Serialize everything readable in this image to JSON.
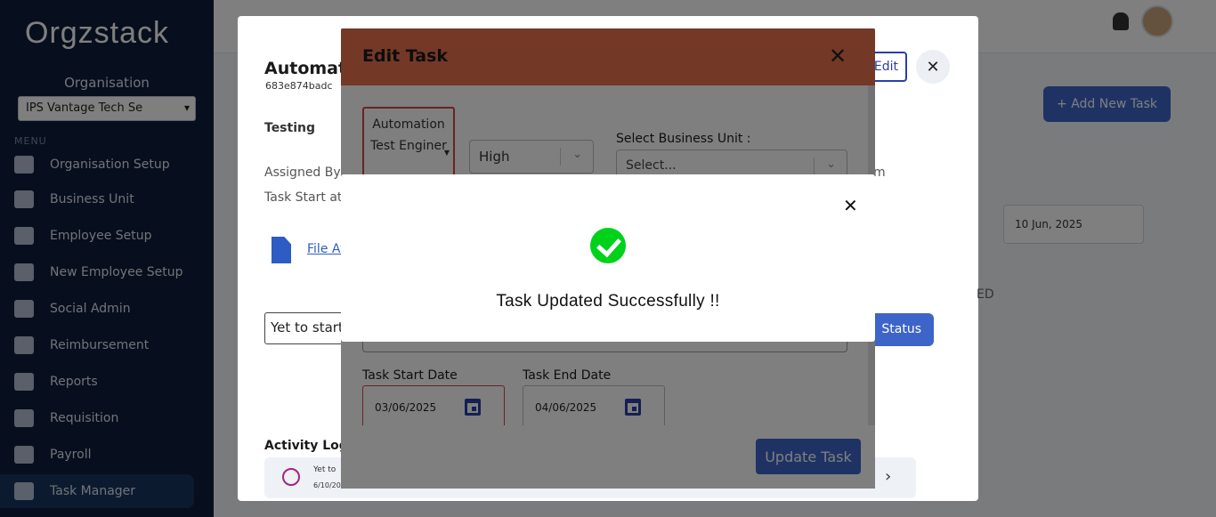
{
  "app": {
    "logo_text": "Orgzstack",
    "organisation_label": "Organisation",
    "organisation_value": "IPS Vantage Tech Se",
    "menu_label": "MENU"
  },
  "sidebar": {
    "items": [
      {
        "label": "Organisation Setup"
      },
      {
        "label": "Business Unit"
      },
      {
        "label": "Employee Setup"
      },
      {
        "label": "New Employee Setup"
      },
      {
        "label": "Social Admin"
      },
      {
        "label": "Reimbursement"
      },
      {
        "label": "Reports"
      },
      {
        "label": "Requisition"
      },
      {
        "label": "Payroll"
      },
      {
        "label": "Task Manager"
      }
    ]
  },
  "page": {
    "add_task_label": "+ Add New Task",
    "date_filter_value": "10 Jun, 2025"
  },
  "task_modal": {
    "title": "Automat",
    "task_id": "683e874badc",
    "description": "Testing",
    "assigned_by": "Assigned By :",
    "task_start": "Task Start at :",
    "right_text": "m",
    "file_link": "File At",
    "status_value": "Yet to start",
    "status_button": "Status",
    "edit_button": "Edit",
    "approved_text": "ED",
    "activity_log_title": "Activity Log",
    "log_text": "Yet to",
    "log_date": "6/10/20"
  },
  "edit_task": {
    "title": "Edit Task",
    "assignee_value": "Automation Test Enginer",
    "priority_value": "High",
    "business_unit_label": "Select Business Unit :",
    "business_unit_placeholder": "Select...",
    "start_date_label": "Task Start Date",
    "end_date_label": "Task End Date",
    "start_date_value": "03/06/2025",
    "end_date_value": "04/06/2025",
    "update_button": "Update Task"
  },
  "success": {
    "message": "Task Updated Successfully !!"
  },
  "colors": {
    "header_orange": "#e8714d",
    "primary_blue": "#3d64c9",
    "success_green": "#00d11b",
    "error_red": "#d6454a"
  }
}
